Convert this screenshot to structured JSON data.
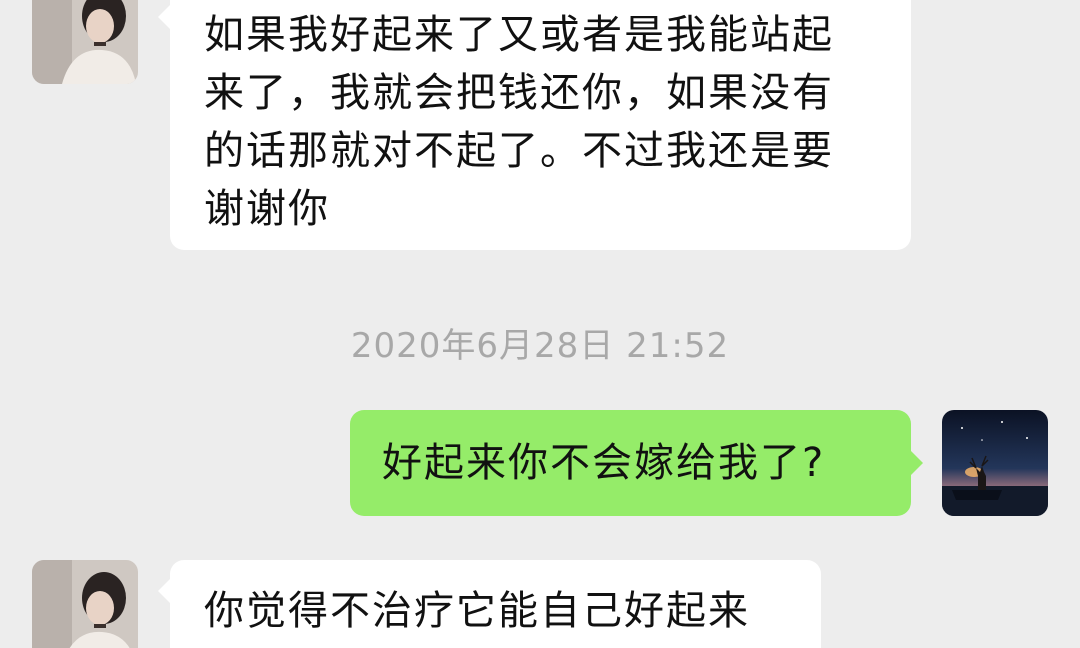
{
  "conversation": {
    "messages": [
      {
        "sender": "contact",
        "lines": [
          "如果我好起来了又或者是我能站起",
          "来了，我就会把钱还你，如果没有",
          "的话那就对不起了。不过我还是要",
          "谢谢你"
        ]
      },
      {
        "sender": "me",
        "lines": [
          "好起来你不会嫁给我了?"
        ]
      },
      {
        "sender": "contact",
        "lines": [
          "你觉得不治疗它能自己好起来"
        ]
      }
    ],
    "timestamp": "2020年6月28日 21:52"
  },
  "colors": {
    "background": "#ededed",
    "incoming_bubble": "#ffffff",
    "outgoing_bubble": "#95ec69",
    "timestamp_text": "#a8a8a8"
  },
  "icons": {
    "contact_avatar": "avatar-girl-photo-icon",
    "my_avatar": "avatar-deer-night-icon"
  }
}
